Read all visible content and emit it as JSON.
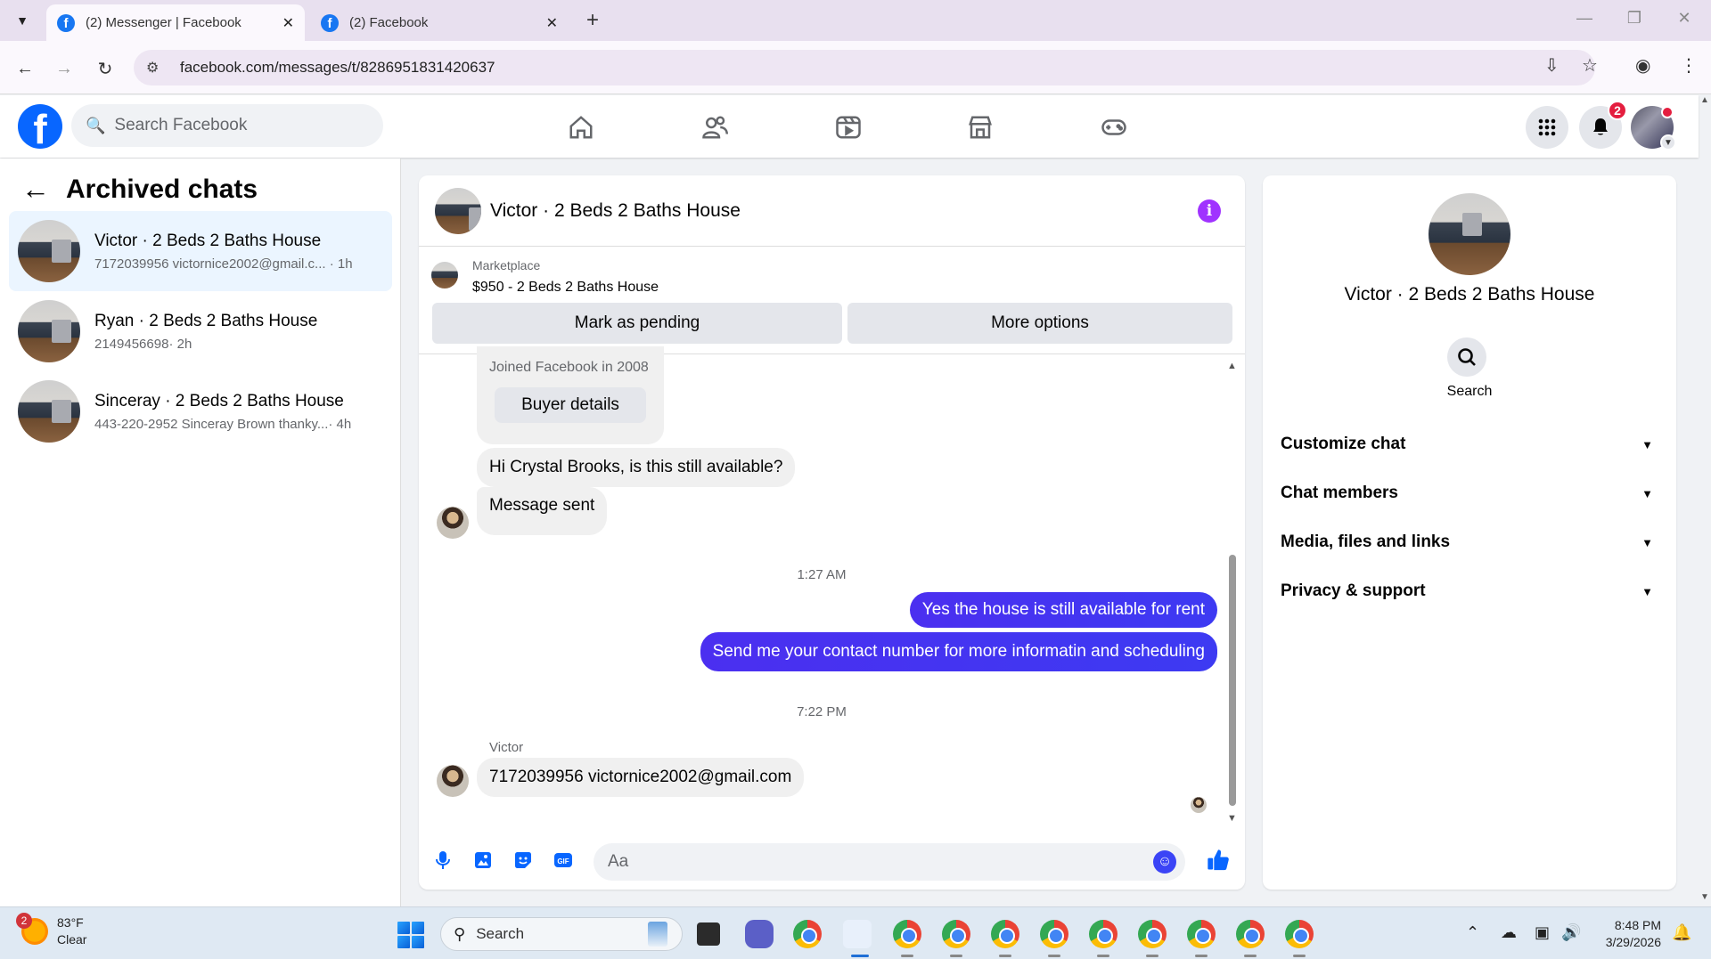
{
  "browser": {
    "tabs": [
      {
        "title": "(2) Messenger | Facebook",
        "active": true
      },
      {
        "title": "(2) Facebook",
        "active": false
      }
    ],
    "url": "facebook.com/messages/t/8286951831420637"
  },
  "fb_nav": {
    "search_placeholder": "Search Facebook",
    "notifications_count": "2"
  },
  "sidebar": {
    "title": "Archived chats",
    "chats": [
      {
        "title": "Victor · 2 Beds 2 Baths House",
        "preview": "7172039956 victornice2002@gmail.c...",
        "time": "· 1h",
        "selected": true
      },
      {
        "title": "Ryan · 2 Beds 2 Baths House",
        "preview": "2149456698",
        "time": "· 2h",
        "selected": false
      },
      {
        "title": "Sinceray · 2 Beds 2 Baths House",
        "preview": "443-220-2952 Sinceray Brown thanky...",
        "time": "· 4h",
        "selected": false
      }
    ]
  },
  "conversation": {
    "title": "Victor · 2 Beds 2 Baths House",
    "marketplace_label": "Marketplace",
    "listing": "$950 - 2 Beds 2 Baths House",
    "mark_pending_label": "Mark as pending",
    "more_options_label": "More options",
    "buyer_joined": "Joined Facebook in 2008",
    "buyer_details_label": "Buyer details",
    "messages": [
      {
        "dir": "in",
        "text": "Hi Crystal Brooks, is this still available?"
      },
      {
        "dir": "in",
        "text": "Message sent"
      },
      {
        "dir": "time",
        "text": "1:27 AM"
      },
      {
        "dir": "out",
        "text": "Yes the house is still available for rent"
      },
      {
        "dir": "out",
        "text": "Send me your contact number for more informatin and  scheduling"
      },
      {
        "dir": "time",
        "text": "7:22 PM"
      },
      {
        "dir": "sender",
        "text": "Victor"
      },
      {
        "dir": "in",
        "text": "7172039956 victornice2002@gmail.com"
      }
    ],
    "composer_placeholder": "Aa"
  },
  "info_panel": {
    "name": "Victor · 2 Beds 2 Baths House",
    "search_label": "Search",
    "sections": [
      "Customize chat",
      "Chat members",
      "Media, files and links",
      "Privacy & support"
    ]
  },
  "taskbar": {
    "weather_temp": "83°F",
    "weather_desc": "Clear",
    "weather_badge": "2",
    "search_label": "Search",
    "time": "8:48 PM",
    "date": "3/29/2026"
  },
  "colors": {
    "fb_blue": "#0866ff",
    "outgoing_bubble": "#4130f1",
    "info_purple": "#a033ff"
  }
}
